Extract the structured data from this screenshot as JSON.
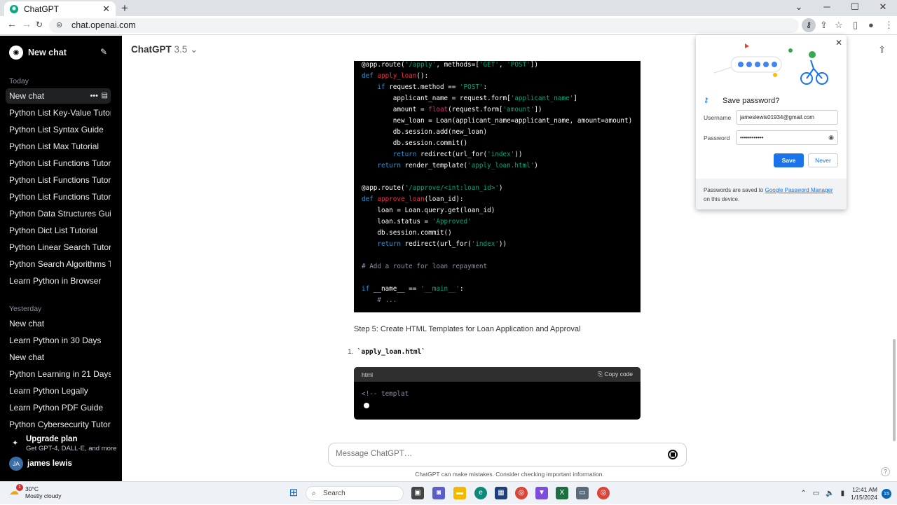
{
  "browser": {
    "tab_title": "ChatGPT",
    "url": "chat.openai.com"
  },
  "sidebar": {
    "new_chat": "New chat",
    "today_label": "Today",
    "today": [
      "New chat",
      "Python List Key-Value Tutorial",
      "Python List Syntax Guide",
      "Python List Max Tutorial",
      "Python List Functions Tutorial",
      "Python List Functions Tutorial",
      "Python List Functions Tutorial",
      "Python Data Structures Guide",
      "Python Dict List Tutorial",
      "Python Linear Search Tutorial",
      "Python Search Algorithms Tutorial",
      "Learn Python in Browser"
    ],
    "yesterday_label": "Yesterday",
    "yesterday": [
      "New chat",
      "Learn Python in 30 Days",
      "New chat",
      "Python Learning in 21 Days",
      "Learn Python Legally",
      "Learn Python PDF Guide",
      "Python Cybersecurity Tutorial"
    ],
    "upgrade_title": "Upgrade plan",
    "upgrade_sub": "Get GPT-4, DALL·E, and more",
    "user_initials": "JA",
    "user_name": "james lewis"
  },
  "main": {
    "model": "ChatGPT",
    "model_version": "3.5",
    "code_lines": [
      [
        [
          "@app.route(",
          "n"
        ],
        [
          "'/apply'",
          "s"
        ],
        [
          ", methods=[",
          "n"
        ],
        [
          "'GET'",
          "s"
        ],
        [
          ", ",
          "n"
        ],
        [
          "'POST'",
          "s"
        ],
        [
          "])",
          "n"
        ]
      ],
      [
        [
          "def ",
          "k"
        ],
        [
          "apply_loan",
          "f"
        ],
        [
          "():",
          "n"
        ]
      ],
      [
        [
          "    if ",
          "k"
        ],
        [
          "request.method == ",
          "n"
        ],
        [
          "'POST'",
          "s"
        ],
        [
          ":",
          "n"
        ]
      ],
      [
        [
          "        applicant_name = request.form[",
          "n"
        ],
        [
          "'applicant_name'",
          "s"
        ],
        [
          "]",
          "n"
        ]
      ],
      [
        [
          "        amount = ",
          "n"
        ],
        [
          "float",
          "d"
        ],
        [
          "(request.form[",
          "n"
        ],
        [
          "'amount'",
          "s"
        ],
        [
          "])",
          "n"
        ]
      ],
      [
        [
          "        new_loan = Loan(applicant_name=applicant_name, amount=amount)",
          "n"
        ]
      ],
      [
        [
          "        db.session.add(new_loan)",
          "n"
        ]
      ],
      [
        [
          "        db.session.commit()",
          "n"
        ]
      ],
      [
        [
          "        return ",
          "k"
        ],
        [
          "redirect(url_for(",
          "n"
        ],
        [
          "'index'",
          "s"
        ],
        [
          "))",
          "n"
        ]
      ],
      [
        [
          "    return ",
          "k"
        ],
        [
          "render_template(",
          "n"
        ],
        [
          "'apply_loan.html'",
          "s"
        ],
        [
          ")",
          "n"
        ]
      ],
      [
        [
          "",
          "n"
        ]
      ],
      [
        [
          "@app.route(",
          "n"
        ],
        [
          "'/approve/<int:loan_id>'",
          "s"
        ],
        [
          ")",
          "n"
        ]
      ],
      [
        [
          "def ",
          "k"
        ],
        [
          "approve_loan",
          "f"
        ],
        [
          "(loan_id):",
          "n"
        ]
      ],
      [
        [
          "    loan = Loan.query.get(loan_id)",
          "n"
        ]
      ],
      [
        [
          "    loan.status = ",
          "n"
        ],
        [
          "'Approved'",
          "s"
        ]
      ],
      [
        [
          "    db.session.commit()",
          "n"
        ]
      ],
      [
        [
          "    return ",
          "k"
        ],
        [
          "redirect(url_for(",
          "n"
        ],
        [
          "'index'",
          "s"
        ],
        [
          "))",
          "n"
        ]
      ],
      [
        [
          "",
          "n"
        ]
      ],
      [
        [
          "# Add a route for loan repayment",
          "cm"
        ]
      ],
      [
        [
          "",
          "n"
        ]
      ],
      [
        [
          "if ",
          "k"
        ],
        [
          "__name__ == ",
          "n"
        ],
        [
          "'__main__'",
          "s"
        ],
        [
          ":",
          "n"
        ]
      ],
      [
        [
          "    # ...",
          "cm"
        ]
      ]
    ],
    "step5": "Step 5: Create HTML Templates for Loan Application and Approval",
    "list_num": "1.",
    "list_item": "`apply_loan.html`",
    "code2_lang": "html",
    "code2_copy": "Copy code",
    "code2_text": "<!-- templat",
    "message_placeholder": "Message ChatGPT…",
    "disclaimer": "ChatGPT can make mistakes. Consider checking important information.",
    "help": "?"
  },
  "password_popup": {
    "title": "Save password?",
    "username_label": "Username",
    "username": "jameslewis01934@gmail.com",
    "password_label": "Password",
    "password": "••••••••••••",
    "save": "Save",
    "never": "Never",
    "footer_pre": "Passwords are saved to ",
    "footer_link": "Google Password Manager",
    "footer_post": " on this device."
  },
  "taskbar": {
    "temp": "30°C",
    "weather": "Mostly cloudy",
    "weather_badge": "1",
    "search": "Search",
    "time": "12:41 AM",
    "date": "1/15/2024",
    "notif": "15"
  },
  "colors": {
    "keyword": "#2e95d3",
    "string": "#00a67d",
    "function": "#f22c3d",
    "comment": "#8e8ea0",
    "accent": "#1a73e8"
  }
}
